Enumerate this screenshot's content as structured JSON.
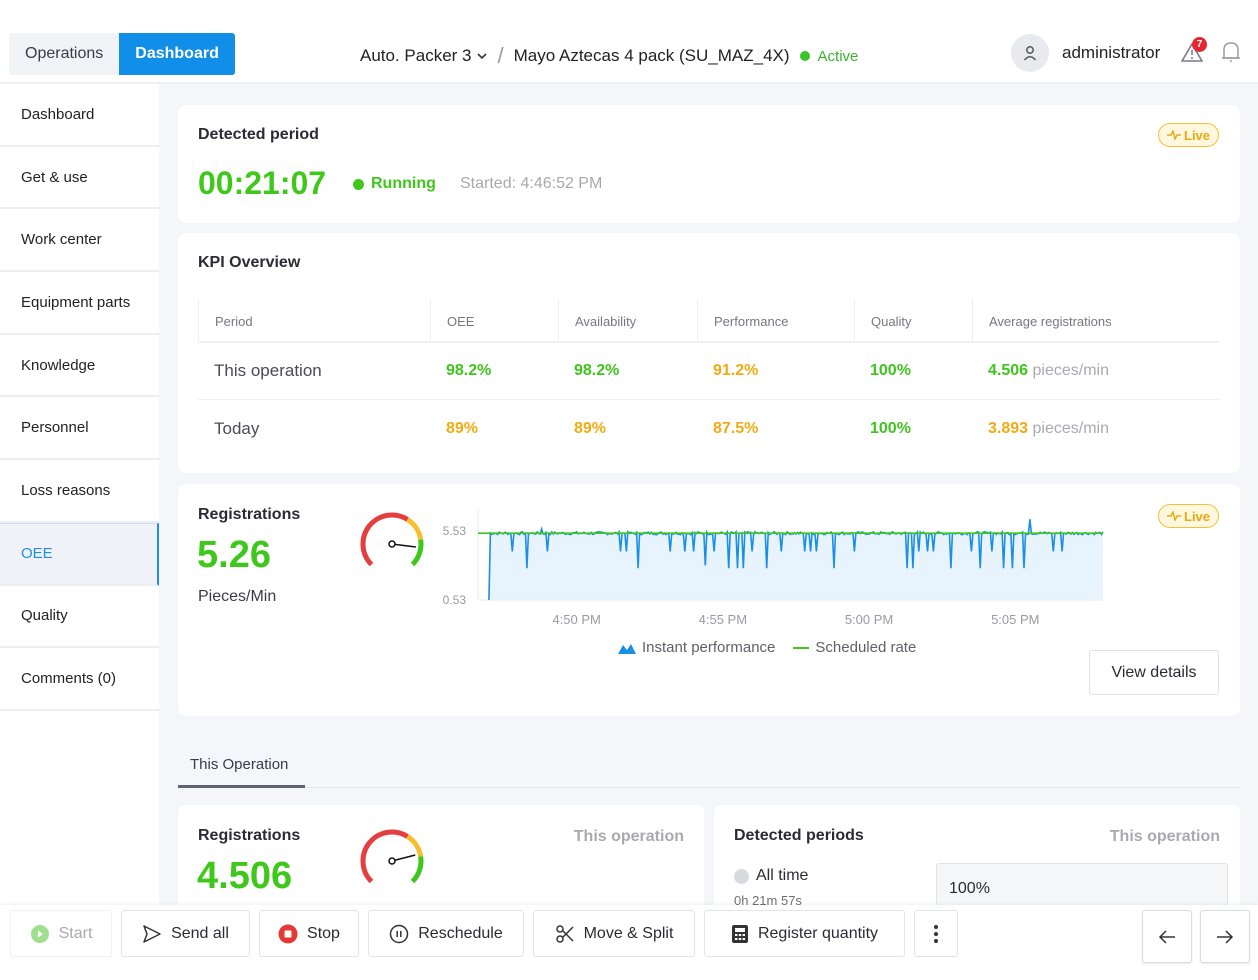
{
  "header": {
    "segments": [
      {
        "label": "Operations",
        "active": false
      },
      {
        "label": "Dashboard",
        "active": true
      }
    ],
    "machine": "Auto. Packer 3",
    "separator": "/",
    "order": "Mayo Aztecas 4 pack (SU_MAZ_4X)",
    "status": "Active",
    "status_color": "#39c32c",
    "user": {
      "name": "administrator",
      "icon": "user-icon"
    },
    "alerts": {
      "icon": "warning-icon",
      "count": "7"
    },
    "notifications": {
      "icon": "bell-icon"
    }
  },
  "sidebar": {
    "items": [
      {
        "label": "Dashboard",
        "active": false
      },
      {
        "label": "Get & use",
        "active": false
      },
      {
        "label": "Work center",
        "active": false
      },
      {
        "label": "Equipment parts",
        "active": false
      },
      {
        "label": "Knowledge",
        "active": false
      },
      {
        "label": "Personnel",
        "active": false
      },
      {
        "label": "Loss reasons",
        "active": false
      },
      {
        "label": "OEE",
        "active": true
      },
      {
        "label": "Quality",
        "active": false
      },
      {
        "label": "Comments (0)",
        "active": false
      }
    ]
  },
  "detected_period": {
    "title": "Detected period",
    "live_label": "Live",
    "duration": "00:21:07",
    "state": "Running",
    "started": "Started: 4:46:52 PM"
  },
  "kpi": {
    "title": "KPI Overview",
    "columns": [
      "Period",
      "OEE",
      "Availability",
      "Performance",
      "Quality",
      "Average registrations"
    ],
    "rows": [
      {
        "period": "This operation",
        "oee": "98.2%",
        "availability": "98.2%",
        "performance": "91.2%",
        "quality": "100%",
        "avg": "4.506",
        "avg_unit": "pieces/min",
        "colors": [
          "green",
          "green",
          "amber",
          "green",
          "green"
        ]
      },
      {
        "period": "Today",
        "oee": "89%",
        "availability": "89%",
        "performance": "87.5%",
        "quality": "100%",
        "avg": "3.893",
        "avg_unit": "pieces/min",
        "colors": [
          "amber",
          "amber",
          "amber",
          "green",
          "amber"
        ]
      }
    ]
  },
  "registrations": {
    "title": "Registrations",
    "value": "5.26",
    "unit": "Pieces/Min",
    "live_label": "Live",
    "gauge_fraction": 0.86,
    "view_details": "View details"
  },
  "chart_data": {
    "type": "area",
    "title": "",
    "ylim": [
      0.53,
      5.53
    ],
    "y_ticks": [
      "5.53",
      "0.53"
    ],
    "x_ticks": [
      "4:50 PM",
      "4:55 PM",
      "5:00 PM",
      "5:05 PM"
    ],
    "x_tick_minutes": [
      50,
      55,
      60,
      65
    ],
    "x_range_minutes": [
      46.9,
      68.0
    ],
    "series": [
      {
        "name": "Instant performance",
        "color": "#1a8fe6",
        "kind": "area",
        "baseline": 5.3,
        "dips": [
          [
            47.0,
            0.53
          ],
          [
            47.8,
            4.0
          ],
          [
            48.3,
            2.8
          ],
          [
            48.8,
            2.8
          ],
          [
            49.0,
            4.0
          ],
          [
            51.5,
            4.0
          ],
          [
            51.7,
            4.0
          ],
          [
            52.1,
            2.8
          ],
          [
            53.2,
            4.0
          ],
          [
            53.7,
            4.0
          ],
          [
            54.0,
            4.0
          ],
          [
            54.4,
            3.0
          ],
          [
            54.7,
            4.0
          ],
          [
            55.2,
            2.8
          ],
          [
            55.5,
            2.8
          ],
          [
            55.7,
            2.8
          ],
          [
            56.0,
            4.0
          ],
          [
            56.5,
            2.8
          ],
          [
            57.0,
            4.0
          ],
          [
            57.8,
            4.0
          ],
          [
            58.0,
            4.0
          ],
          [
            58.2,
            4.0
          ],
          [
            58.8,
            2.8
          ],
          [
            59.5,
            4.0
          ],
          [
            61.3,
            2.8
          ],
          [
            61.5,
            2.8
          ],
          [
            61.7,
            4.0
          ],
          [
            62.0,
            4.0
          ],
          [
            62.2,
            4.0
          ],
          [
            62.8,
            2.8
          ],
          [
            63.5,
            4.0
          ],
          [
            63.8,
            2.8
          ],
          [
            64.2,
            4.0
          ],
          [
            64.6,
            2.8
          ],
          [
            64.9,
            2.8
          ],
          [
            65.3,
            2.8
          ],
          [
            66.3,
            4.0
          ],
          [
            66.6,
            4.0
          ]
        ],
        "spikes": [
          [
            48.8,
            5.6
          ],
          [
            65.5,
            6.3
          ]
        ]
      },
      {
        "name": "Scheduled rate",
        "color": "#3fc81c",
        "kind": "line",
        "value": 5.3
      }
    ],
    "legend": [
      "Instant performance",
      "Scheduled rate"
    ],
    "legend_position": "bottom"
  },
  "tabs": [
    {
      "label": "This Operation",
      "active": true
    }
  ],
  "op_registrations": {
    "title": "Registrations",
    "scope": "This operation",
    "value": "4.506",
    "gauge_fraction": 0.78
  },
  "detected_periods": {
    "title": "Detected periods",
    "scope": "This operation",
    "option": "All time",
    "option_sub": "0h 21m 57s",
    "percent": "100%"
  },
  "footer": {
    "buttons": [
      {
        "label": "Start",
        "icon": "play-icon",
        "disabled": true
      },
      {
        "label": "Send all",
        "icon": "send-icon"
      },
      {
        "label": "Stop",
        "icon": "stop-icon"
      },
      {
        "label": "Reschedule",
        "icon": "pause-icon"
      },
      {
        "label": "Move & Split",
        "icon": "scissors-icon"
      },
      {
        "label": "Register quantity",
        "icon": "calculator-icon"
      }
    ],
    "more_icon": "more-vertical-icon",
    "prev_icon": "arrow-left-icon",
    "next_icon": "arrow-right-icon"
  }
}
